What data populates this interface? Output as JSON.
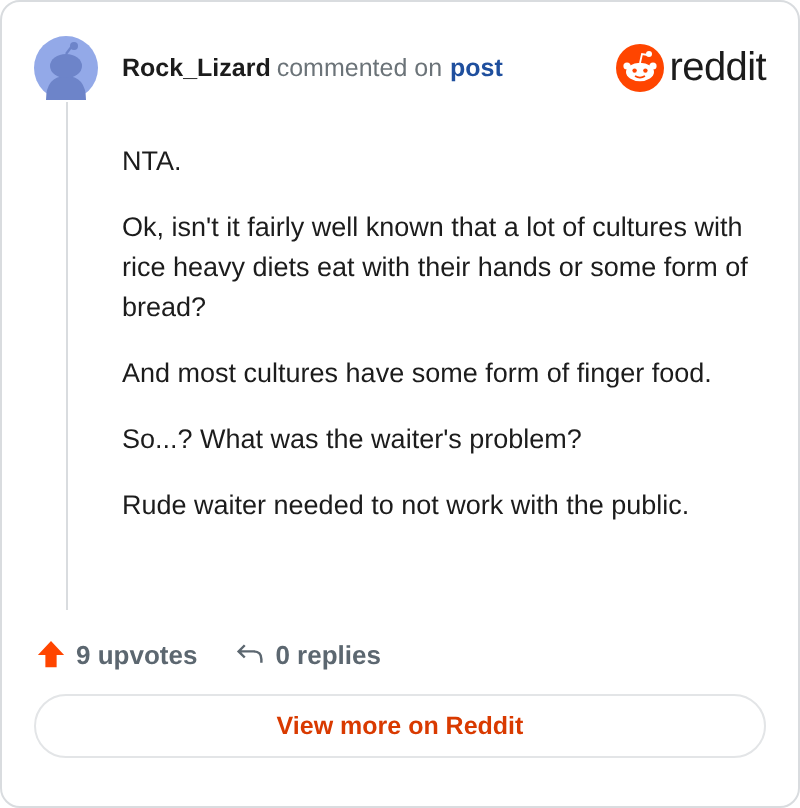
{
  "comment": {
    "author": "Rock_Lizard",
    "action": "commented on",
    "target": "post"
  },
  "brand": "reddit",
  "paragraphs": [
    "NTA.",
    "Ok, isn't it fairly well known that a lot of cultures with rice heavy diets eat with their hands or some form of bread?",
    "And most cultures have some form of finger food.",
    "So...? What was the waiter's problem?",
    "Rude waiter needed to not work with the public."
  ],
  "upvotes": "9 upvotes",
  "replies": "0 replies",
  "button": "View more on Reddit"
}
